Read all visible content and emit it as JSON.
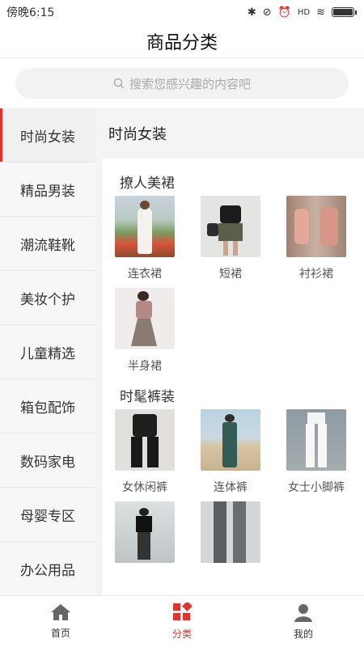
{
  "status": {
    "time": "傍晚6:15",
    "signal_label": "HD"
  },
  "page": {
    "title": "商品分类"
  },
  "search": {
    "placeholder": "搜索您感兴趣的内容吧"
  },
  "sidebar": {
    "items": [
      {
        "label": "时尚女装"
      },
      {
        "label": "精品男装"
      },
      {
        "label": "潮流鞋靴"
      },
      {
        "label": "美妆个护"
      },
      {
        "label": "儿童精选"
      },
      {
        "label": "箱包配饰"
      },
      {
        "label": "数码家电"
      },
      {
        "label": "母婴专区"
      },
      {
        "label": "办公用品"
      }
    ]
  },
  "content": {
    "title": "时尚女装",
    "groups": [
      {
        "title": "撩人美裙",
        "items": [
          {
            "label": "连衣裙",
            "image": "white-dress-field-photo"
          },
          {
            "label": "短裙",
            "image": "black-top-short-skirt-photo"
          },
          {
            "label": "衬衫裙",
            "image": "pink-shirt-dress-photo"
          },
          {
            "label": "半身裙",
            "image": "pleated-midi-skirt-photo"
          }
        ]
      },
      {
        "title": "时髦裤装",
        "items": [
          {
            "label": "女休闲裤",
            "image": "black-casual-pants-photo"
          },
          {
            "label": "连体裤",
            "image": "green-jumpsuit-photo"
          },
          {
            "label": "女士小脚裤",
            "image": "white-skinny-jeans-photo"
          },
          {
            "label": "",
            "image": "black-outfit-street-photo"
          },
          {
            "label": "",
            "image": "grey-trousers-photo"
          }
        ]
      }
    ]
  },
  "tabbar": {
    "items": [
      {
        "label": "首页",
        "icon": "home-icon"
      },
      {
        "label": "分类",
        "icon": "category-icon"
      },
      {
        "label": "我的",
        "icon": "profile-icon"
      }
    ]
  },
  "colors": {
    "accent": "#e0322f",
    "search_bg": "#f2f2f2"
  }
}
